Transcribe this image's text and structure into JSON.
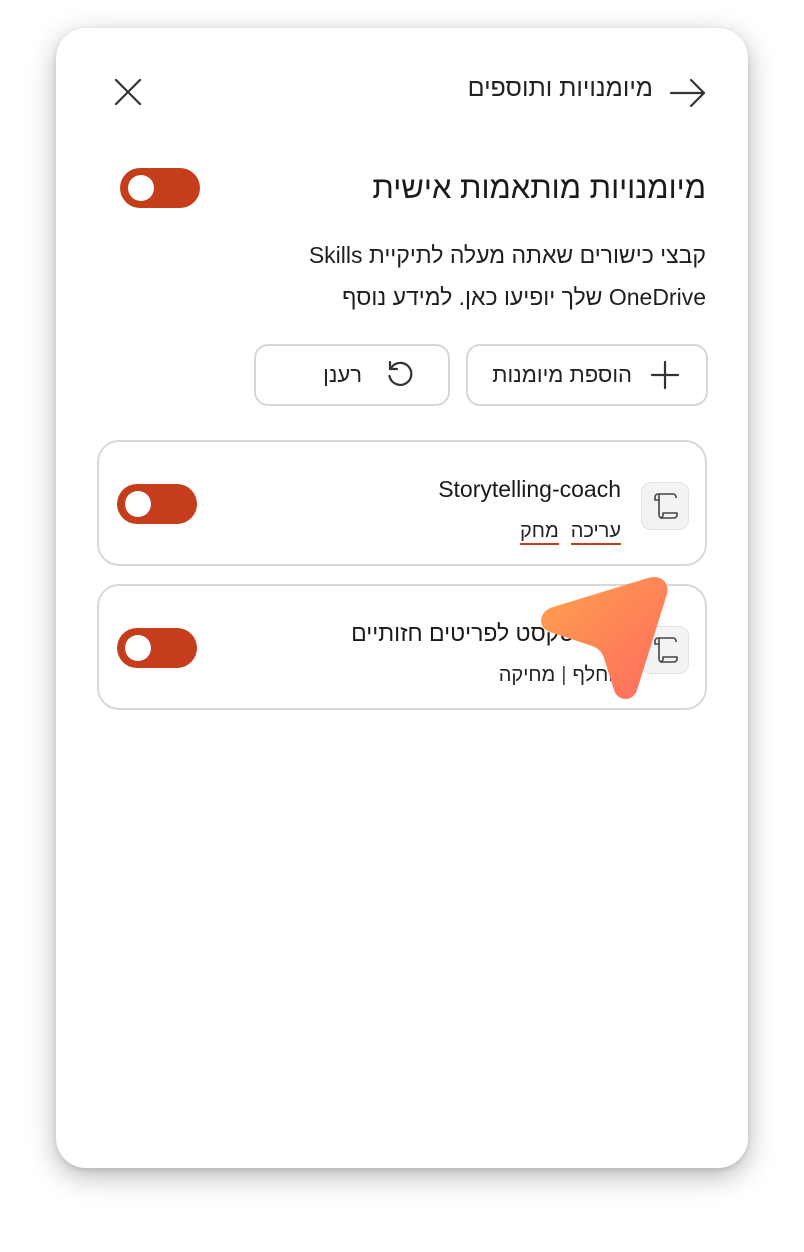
{
  "header": {
    "title": "מיומנויות ותוספים",
    "back_icon": "arrow-right-icon",
    "close_icon": "close-icon"
  },
  "custom_skills": {
    "title": "מיומנויות מותאמות אישית",
    "toggle_on": true,
    "description_line1": "קבצי כישורים שאתה מעלה לתיקיית Skills",
    "description_line2": "OneDrive שלך יופיעו כאן. למידע נוסף"
  },
  "actions": {
    "add_label": "הוספת מיומנות",
    "refresh_label": "רענן"
  },
  "skills": [
    {
      "name": "Storytelling-coach",
      "actions": [
        "עריכה",
        "מחק"
      ],
      "separator": "",
      "toggle_on": true,
      "icon": "scroll-icon"
    },
    {
      "name": "כסוי-טקסט לפריטים חזותיים",
      "actions": [
        "החלף",
        "מחיקה"
      ],
      "separator": "|",
      "toggle_on": true,
      "icon": "scroll-icon"
    }
  ],
  "colors": {
    "accent": "#c43e1c",
    "cursor_start": "#ffa24d",
    "cursor_end": "#ff6a5f"
  }
}
